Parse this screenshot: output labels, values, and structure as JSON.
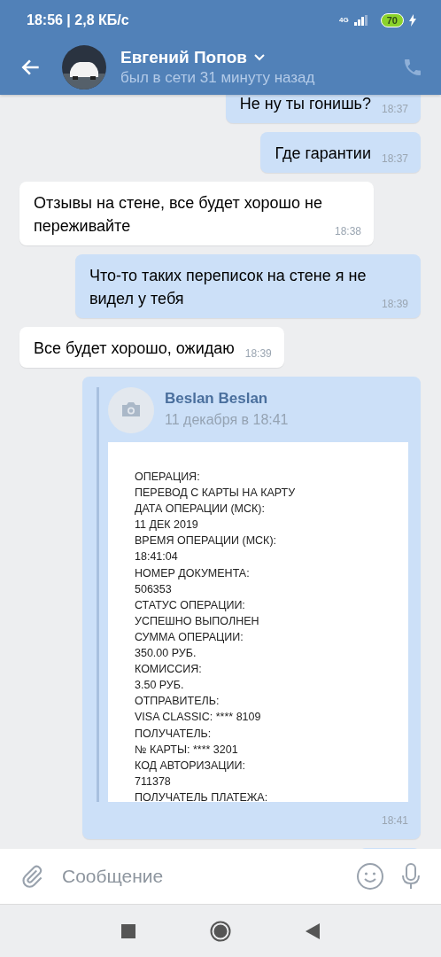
{
  "status_bar": {
    "time": "18:56 | 2,8 КБ/с",
    "network": "4G",
    "battery": "70"
  },
  "header": {
    "name": "Евгений Попов",
    "presence": "был в сети 31 минуту назад"
  },
  "messages": [
    {
      "kind": "text",
      "outgoing": true,
      "text": "Не ну ты гонишь?",
      "time": "18:37"
    },
    {
      "kind": "text",
      "outgoing": true,
      "text": "Где гарантии",
      "time": "18:37"
    },
    {
      "kind": "text",
      "outgoing": false,
      "text": "Отзывы на стене, все будет хорошо не переживайте",
      "time": "18:38"
    },
    {
      "kind": "text",
      "outgoing": true,
      "text": "Что-то таких переписок на стене я не видел у тебя",
      "time": "18:39"
    },
    {
      "kind": "text",
      "outgoing": false,
      "text": "Все будет хорошо, ожидаю",
      "time": "18:39"
    },
    {
      "kind": "forward",
      "outgoing": true,
      "author": "Beslan Beslan",
      "date": "11 декабря в 18:41",
      "time": "18:41",
      "document": [
        "ОПЕРАЦИЯ:",
        "ПЕРЕВОД С КАРТЫ НА КАРТУ",
        "ДАТА ОПЕРАЦИИ (МСК):",
        "11 ДЕК 2019",
        "ВРЕМЯ ОПЕРАЦИИ (МСК):",
        "18:41:04",
        "НОМЕР ДОКУМЕНТА:",
        "506353",
        "СТАТУС ОПЕРАЦИИ:",
        "УСПЕШНО ВЫПОЛНЕН",
        "СУММА ОПЕРАЦИИ:",
        "350.00 РУБ.",
        "КОМИССИЯ:",
        "3.50 РУБ.",
        "ОТПРАВИТЕЛЬ:",
        "VISA CLASSIC: **** 8109",
        "ПОЛУЧАТЕЛЬ:",
        "№ КАРТЫ: **** 3201",
        "КОД АВТОРИЗАЦИИ:",
        "711378",
        "ПОЛУЧАТЕЛЬ ПЛАТЕЖА:"
      ]
    },
    {
      "kind": "cut",
      "outgoing": true
    }
  ],
  "composer": {
    "placeholder": "Сообщение"
  }
}
